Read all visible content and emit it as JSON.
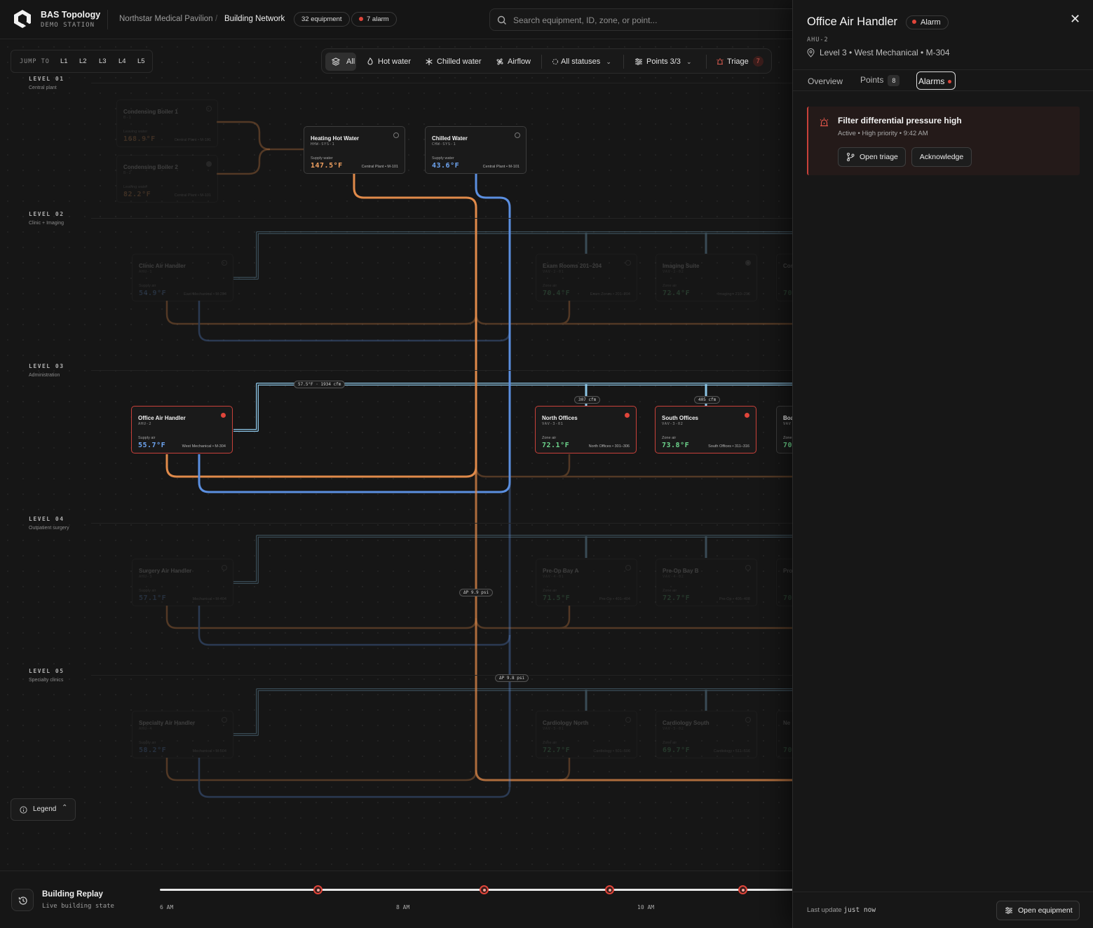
{
  "app": {
    "title": "BAS Topology",
    "subtitle": "DEMO STATION"
  },
  "breadcrumb": {
    "site": "Northstar Medical Pavilion",
    "view": "Building Network"
  },
  "badges": {
    "equipment": "32 equipment",
    "alarms": "7 alarm"
  },
  "search": {
    "placeholder": "Search equipment, ID, zone, or point..."
  },
  "jump": {
    "label": "JUMP TO",
    "levels": [
      "L1",
      "L2",
      "L3",
      "L4",
      "L5"
    ]
  },
  "filters": {
    "all": "All",
    "hot_water": "Hot water",
    "chilled_water": "Chilled water",
    "airflow": "Airflow",
    "statuses": "All statuses",
    "points": "Points 3/3",
    "triage": "Triage",
    "triage_count": "7"
  },
  "levels": [
    {
      "name": "LEVEL 01",
      "sub": "Central plant"
    },
    {
      "name": "LEVEL 02",
      "sub": "Clinic + Imaging"
    },
    {
      "name": "LEVEL 03",
      "sub": "Administration"
    },
    {
      "name": "LEVEL 04",
      "sub": "Outpatient surgery"
    },
    {
      "name": "LEVEL 05",
      "sub": "Specialty clinics"
    }
  ],
  "nodes": {
    "boiler1": {
      "title": "Condensing Boiler 1",
      "id": "B-1",
      "label": "Leaving water",
      "value": "168.9°F",
      "loc": "Central Plant • M-101"
    },
    "boiler2": {
      "title": "Condensing Boiler 2",
      "id": "B-2",
      "label": "Leaving water",
      "value": "82.2°F",
      "loc": "Central Plant • M-101"
    },
    "hhw": {
      "title": "Heating Hot Water",
      "id": "HHW-SYS-1",
      "label": "Supply water",
      "value": "147.5°F",
      "loc": "Central Plant • M-101"
    },
    "chw": {
      "title": "Chilled Water",
      "id": "CHW-SYS-1",
      "label": "Supply water",
      "value": "43.6°F",
      "loc": "Central Plant • M-101"
    },
    "clinic_ahu": {
      "title": "Clinic Air Handler",
      "id": "AHU-1",
      "label": "Supply air",
      "value": "54.9°F",
      "loc": "East Mechanical • M-204"
    },
    "exam": {
      "title": "Exam Rooms 201–204",
      "id": "VAV-2-01",
      "label": "Zone air",
      "value": "70.4°F",
      "loc": "Exam Zones • 201–204"
    },
    "imaging": {
      "title": "Imaging Suite",
      "id": "VAV-2-02",
      "label": "Zone air",
      "value": "72.4°F",
      "loc": "Imaging • 210–216"
    },
    "l2_partial": {
      "title": "Con",
      "value": "70"
    },
    "office_ahu": {
      "title": "Office Air Handler",
      "id": "AHU-2",
      "label": "Supply air",
      "value": "55.7°F",
      "loc": "West Mechanical • M-304"
    },
    "north": {
      "title": "North Offices",
      "id": "VAV-3-01",
      "label": "Zone air",
      "value": "72.1°F",
      "loc": "North Offices • 301–306"
    },
    "south": {
      "title": "South Offices",
      "id": "VAV-3-02",
      "label": "Zone air",
      "value": "73.8°F",
      "loc": "South Offices • 311–316"
    },
    "l3_partial": {
      "title": "Boa",
      "id": "VAV",
      "label": "Zone",
      "value": "70."
    },
    "surgery_ahu": {
      "title": "Surgery Air Handler",
      "id": "AHU-3",
      "label": "Supply air",
      "value": "57.1°F",
      "loc": "Mechanical • M-404"
    },
    "preop_a": {
      "title": "Pre-Op Bay A",
      "id": "VAV-4-01",
      "label": "Zone air",
      "value": "71.5°F",
      "loc": "Pre-Op • 401–404"
    },
    "preop_b": {
      "title": "Pre-Op Bay B",
      "id": "VAV-4-02",
      "label": "Zone air",
      "value": "72.7°F",
      "loc": "Pre-Op • 405–408"
    },
    "l4_partial": {
      "title": "Pro",
      "value": "70"
    },
    "specialty_ahu": {
      "title": "Specialty Air Handler",
      "id": "AHU-4",
      "label": "Supply air",
      "value": "58.2°F",
      "loc": "Mechanical • M-504"
    },
    "cardio_n": {
      "title": "Cardiology North",
      "id": "VAV-5-01",
      "label": "Zone air",
      "value": "72.7°F",
      "loc": "Cardiology • 501–506"
    },
    "cardio_s": {
      "title": "Cardiology South",
      "id": "VAV-5-02",
      "label": "Zone air",
      "value": "69.7°F",
      "loc": "Cardiology • 511–516"
    },
    "l5_partial": {
      "title": "Ne",
      "value": "70"
    }
  },
  "flow_tags": {
    "supply": "57.5°F · 1934 cfm",
    "north_cfm": "307 cfm",
    "south_cfm": "405 cfm",
    "dp_hw": "ΔP 9.9 psi",
    "dp_cw": "ΔP 9.8 psi"
  },
  "colors": {
    "hot_water": "#e08a4a",
    "chilled_water": "#5b8fe0",
    "airflow": "#8cc5e6",
    "alarm": "#e0453a",
    "zone_temp": "#6dd48c"
  },
  "legend": {
    "label": "Legend"
  },
  "replay": {
    "title": "Building Replay",
    "subtitle": "Live building state",
    "ticks": [
      "6 AM",
      "8 AM",
      "10 AM"
    ],
    "alarm_markers": 4
  },
  "panel": {
    "title": "Office Air Handler",
    "status": "Alarm",
    "id": "AHU-2",
    "location": "Level 3 • West Mechanical • M-304",
    "tabs": {
      "overview": "Overview",
      "points": "Points",
      "points_count": "8",
      "alarms": "Alarms"
    },
    "alarm": {
      "title": "Filter differential pressure high",
      "detail": "Active • High priority • 9:42 AM",
      "triage_btn": "Open triage",
      "ack_btn": "Acknowledge"
    },
    "footer": {
      "prefix": "Last update",
      "value": "just now",
      "button": "Open equipment"
    }
  }
}
